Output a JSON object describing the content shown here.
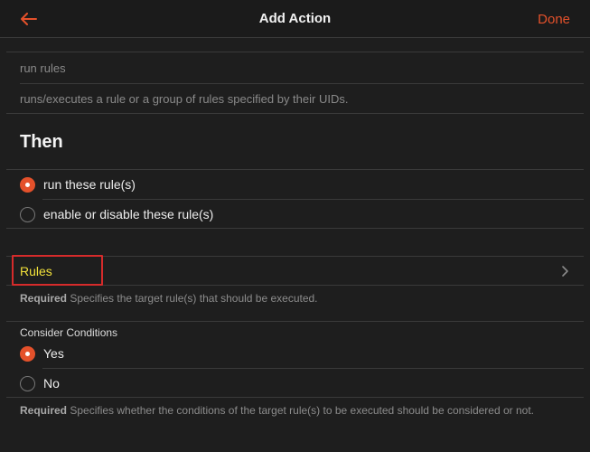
{
  "header": {
    "title": "Add Action",
    "done_label": "Done",
    "accent_color": "#e4512b"
  },
  "description": {
    "name": "run rules",
    "detail": "runs/executes a rule or a group of rules specified by their UIDs."
  },
  "then_section": {
    "title": "Then",
    "options": [
      {
        "label": "run these rule(s)",
        "selected": true
      },
      {
        "label": "enable or disable these rule(s)",
        "selected": false
      }
    ]
  },
  "rules": {
    "label": "Rules",
    "label_color": "#f3e23a",
    "highlight_color": "#d62b2b",
    "help_required": "Required",
    "help_text": "Specifies the target rule(s) that should be executed."
  },
  "consider_conditions": {
    "title": "Consider Conditions",
    "options": [
      {
        "label": "Yes",
        "selected": true
      },
      {
        "label": "No",
        "selected": false
      }
    ],
    "help_required": "Required",
    "help_text": "Specifies whether the conditions of the target rule(s) to be executed should be considered or not."
  }
}
